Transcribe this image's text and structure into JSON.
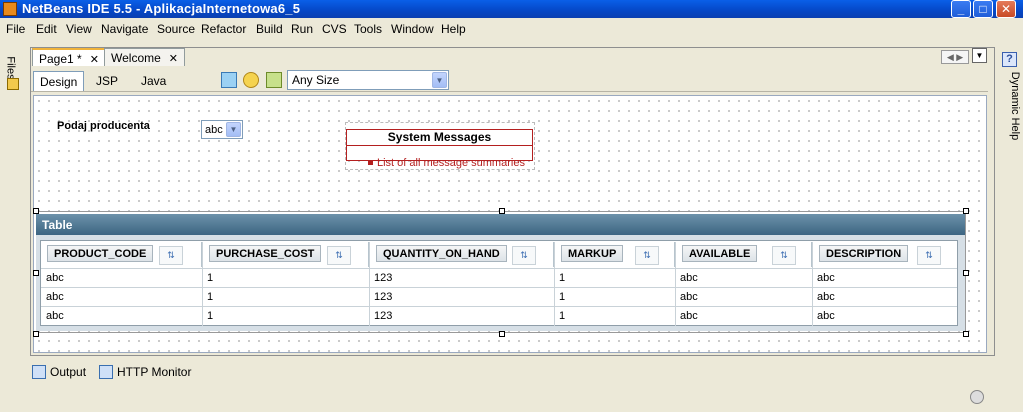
{
  "window": {
    "title": "NetBeans IDE 5.5 - AplikacjaInternetowa6_5",
    "min_glyph": "_",
    "max_glyph": "□",
    "close_glyph": "✕"
  },
  "menu": [
    "File",
    "Edit",
    "View",
    "Navigate",
    "Source",
    "Refactor",
    "Build",
    "Run",
    "CVS",
    "Tools",
    "Window",
    "Help"
  ],
  "side": {
    "files_label": "Files",
    "dynamic_help_label": "Dynamic Help",
    "help_glyph": "?"
  },
  "doc_tabs": {
    "page1": "Page1 *",
    "welcome": "Welcome",
    "close_glyph": "✕",
    "nav_glyph": "◀ ▶",
    "list_glyph": "▼"
  },
  "view_tabs": {
    "design": "Design",
    "jsp": "JSP",
    "java": "Java"
  },
  "size_select": {
    "value": "Any Size",
    "arrow": "▼"
  },
  "form": {
    "producer_label": "Podaj producenta",
    "producer_value": "abc",
    "arrow": "▼"
  },
  "messages": {
    "title": "System Messages",
    "item": "List of all message summaries"
  },
  "table": {
    "title": "Table",
    "sort_glyph": "⇅",
    "columns": [
      "PRODUCT_CODE",
      "PURCHASE_COST",
      "QUANTITY_ON_HAND",
      "MARKUP",
      "AVAILABLE",
      "DESCRIPTION"
    ],
    "rows": [
      [
        "abc",
        "1",
        "123",
        "1",
        "abc",
        "abc"
      ],
      [
        "abc",
        "1",
        "123",
        "1",
        "abc",
        "abc"
      ],
      [
        "abc",
        "1",
        "123",
        "1",
        "abc",
        "abc"
      ]
    ]
  },
  "bottom": {
    "output": "Output",
    "http_monitor": "HTTP Monitor"
  },
  "colors": {
    "title_bar": "#0547C6",
    "table_header": "#3c6582",
    "message_red": "#b41f1f"
  }
}
